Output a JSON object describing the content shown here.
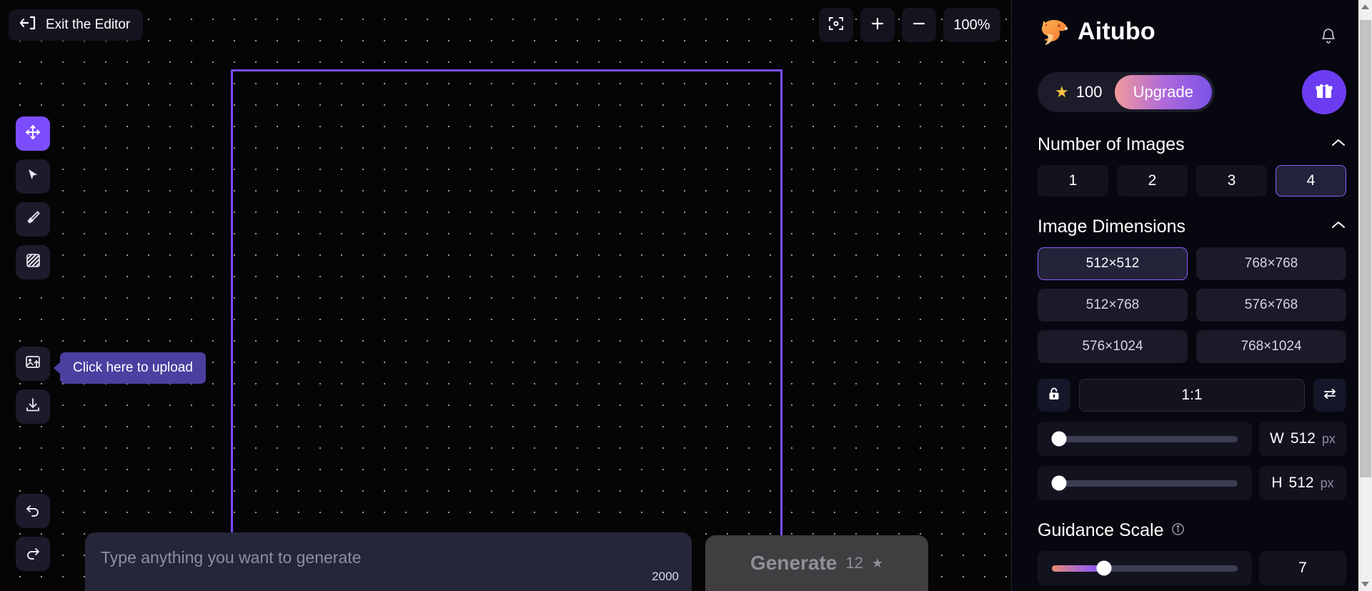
{
  "editor": {
    "exit_label": "Exit the Editor",
    "exit_icon": "arrow-left-exit-icon",
    "zoom_level": "100%",
    "fit_icon": "fit-to-screen-icon",
    "zoom_in_icon": "plus-icon",
    "zoom_out_icon": "minus-icon",
    "tools": [
      {
        "name": "move-tool",
        "icon": "move-arrows-icon",
        "selected": true
      },
      {
        "name": "select-tool",
        "icon": "cursor-arrow-icon",
        "selected": false
      },
      {
        "name": "brush-tool",
        "icon": "paintbrush-icon",
        "selected": false
      },
      {
        "name": "mask-tool",
        "icon": "hatched-square-icon",
        "selected": false
      },
      {
        "name": "upload-image-tool",
        "icon": "image-upload-icon",
        "selected": false
      },
      {
        "name": "download-tool",
        "icon": "download-icon",
        "selected": false
      }
    ],
    "history": [
      {
        "name": "undo-button",
        "icon": "undo-arrow-icon"
      },
      {
        "name": "redo-button",
        "icon": "redo-arrow-icon"
      }
    ],
    "tooltip": "Click here to upload",
    "selection_border_color": "#7c4dff"
  },
  "prompt": {
    "placeholder": "Type anything you want to generate",
    "value": "",
    "char_limit": "2000",
    "generate_label": "Generate",
    "generate_cost": "12",
    "generate_star_icon": "star-icon"
  },
  "panel": {
    "brand": "Aitubo",
    "brand_logo_icon": "aitubo-fox-logo-icon",
    "bell_icon": "notification-bell-icon",
    "credits": "100",
    "credit_star_icon": "star-icon",
    "upgrade_label": "Upgrade",
    "gift_icon": "gift-box-icon",
    "number_of_images": {
      "title": "Number of Images",
      "collapse_icon": "chevron-up-icon",
      "options": [
        "1",
        "2",
        "3",
        "4"
      ],
      "selected": "4"
    },
    "image_dimensions": {
      "title": "Image Dimensions",
      "collapse_icon": "chevron-up-icon",
      "options": [
        "512×512",
        "768×768",
        "512×768",
        "576×768",
        "576×1024",
        "768×1024"
      ],
      "selected": "512×512",
      "lock_icon": "unlock-icon",
      "ratio": "1:1",
      "swap_icon": "swap-arrows-icon",
      "width": {
        "axis": "W",
        "value": "512",
        "unit": "px",
        "percent": 4
      },
      "height": {
        "axis": "H",
        "value": "512",
        "unit": "px",
        "percent": 4
      }
    },
    "guidance_scale": {
      "title": "Guidance Scale",
      "info_icon": "info-circle-icon",
      "value": "7",
      "percent": 28
    },
    "accent_color": "#7c4dff",
    "upgrade_gradient": "#b06ad9"
  },
  "scrollbar": {
    "up_icon": "scroll-up-arrow-icon",
    "down_icon": "scroll-down-arrow-icon"
  }
}
